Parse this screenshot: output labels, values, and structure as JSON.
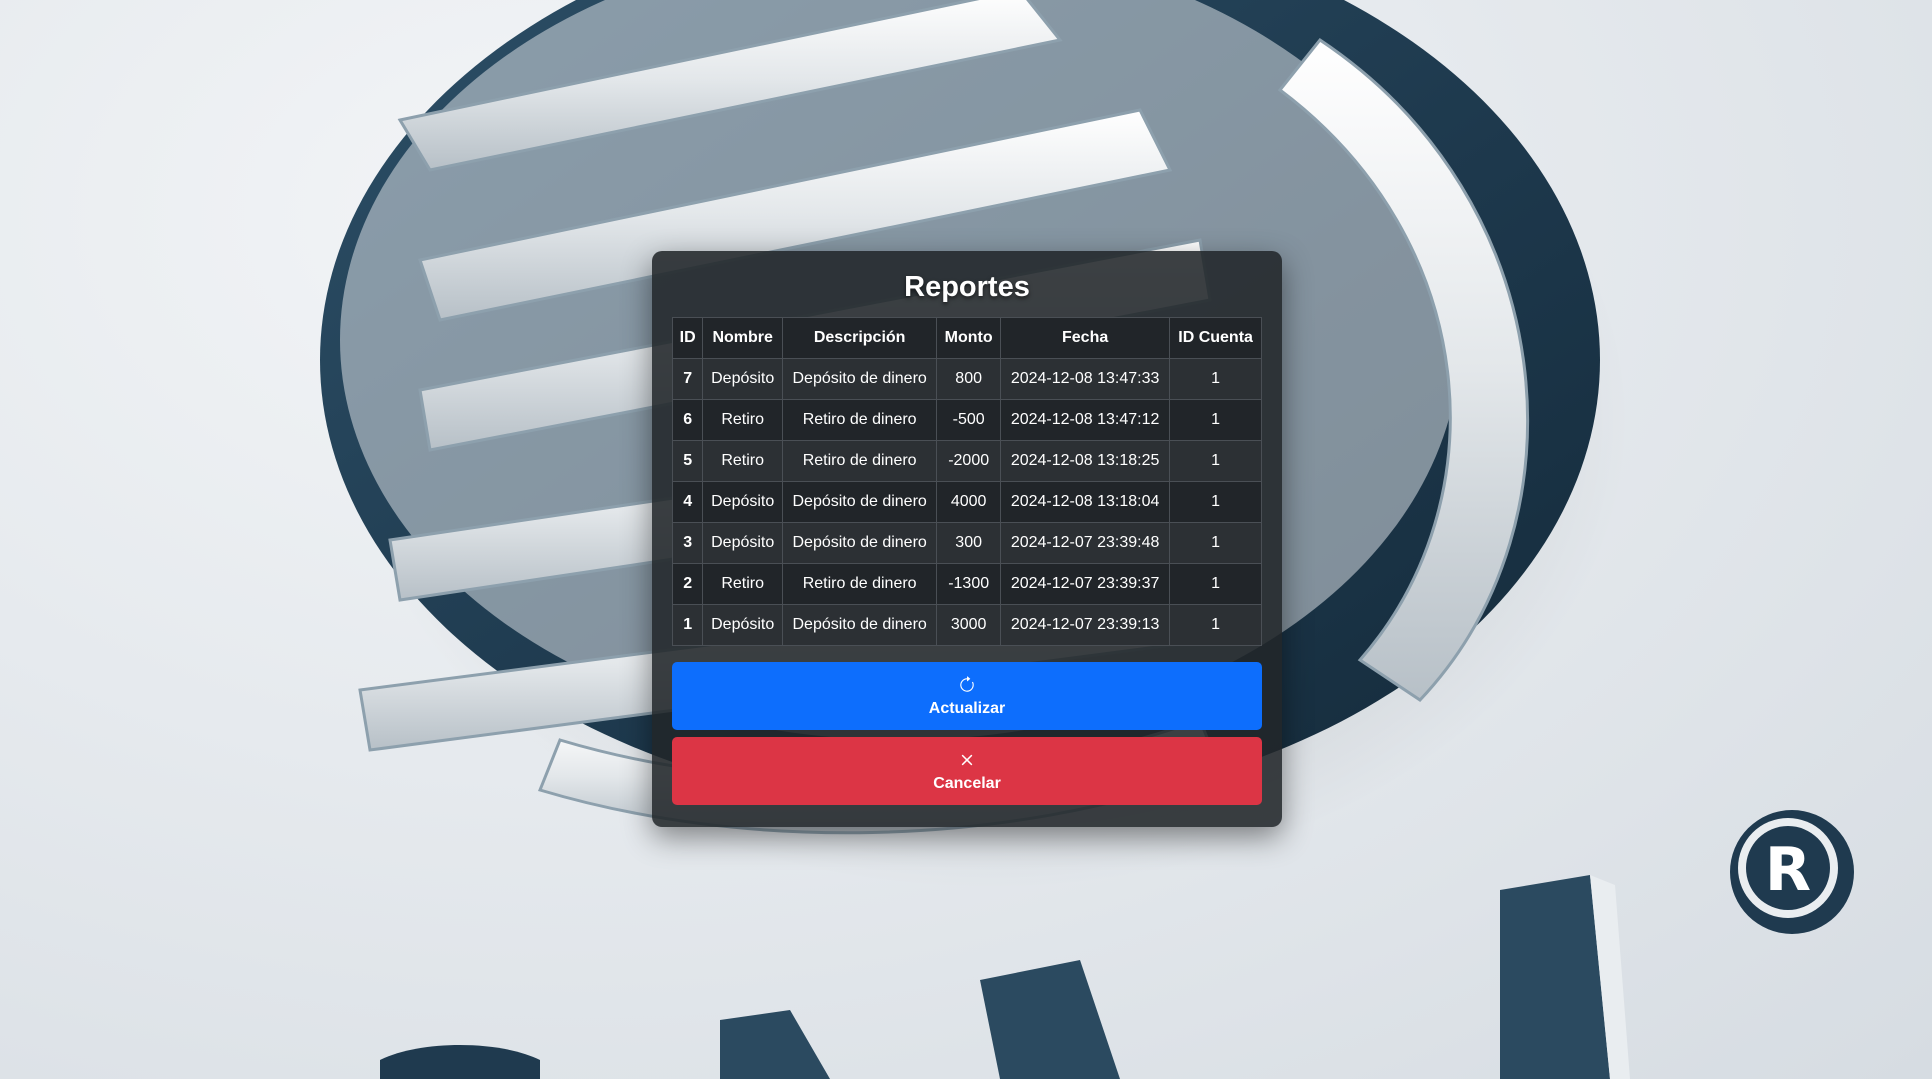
{
  "modal": {
    "title": "Reportes"
  },
  "table": {
    "headers": [
      "ID",
      "Nombre",
      "Descripción",
      "Monto",
      "Fecha",
      "ID Cuenta"
    ],
    "rows": [
      [
        "7",
        "Depósito",
        "Depósito de dinero",
        "800",
        "2024-12-08 13:47:33",
        "1"
      ],
      [
        "6",
        "Retiro",
        "Retiro de dinero",
        "-500",
        "2024-12-08 13:47:12",
        "1"
      ],
      [
        "5",
        "Retiro",
        "Retiro de dinero",
        "-2000",
        "2024-12-08 13:18:25",
        "1"
      ],
      [
        "4",
        "Depósito",
        "Depósito de dinero",
        "4000",
        "2024-12-08 13:18:04",
        "1"
      ],
      [
        "3",
        "Depósito",
        "Depósito de dinero",
        "300",
        "2024-12-07 23:39:48",
        "1"
      ],
      [
        "2",
        "Retiro",
        "Retiro de dinero",
        "-1300",
        "2024-12-07 23:39:37",
        "1"
      ],
      [
        "1",
        "Depósito",
        "Depósito de dinero",
        "3000",
        "2024-12-07 23:39:13",
        "1"
      ]
    ]
  },
  "buttons": {
    "refresh": {
      "label": "Actualizar",
      "icon": "refresh-icon",
      "color": "#0d6efd"
    },
    "cancel": {
      "label": "Cancelar",
      "icon": "close-icon",
      "color": "#dc3545"
    }
  },
  "background": {
    "logo_badge": "R",
    "colors": {
      "primary": "#1f3a4f",
      "light": "#e9edf0"
    }
  }
}
